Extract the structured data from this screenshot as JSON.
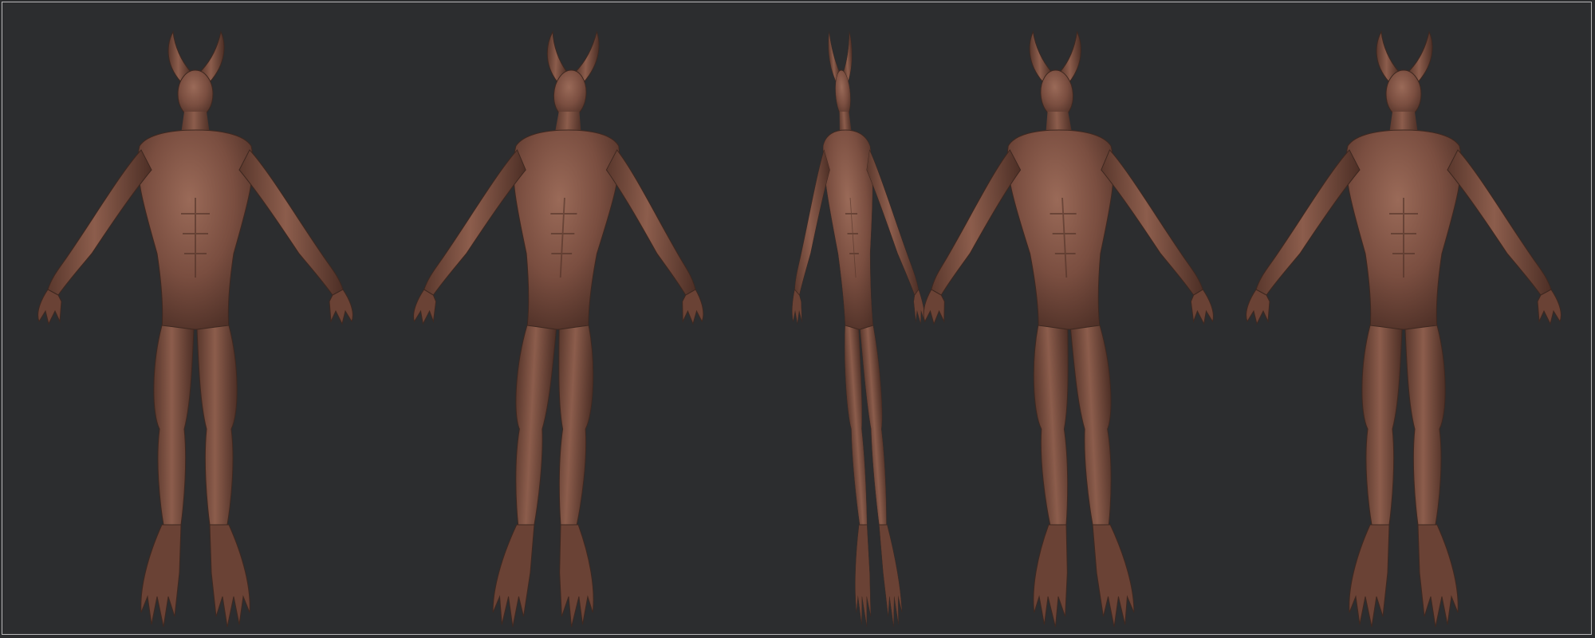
{
  "scene": {
    "subject": "horned-demon-sculpt",
    "views": [
      "front",
      "three-quarter-front",
      "side",
      "three-quarter-back",
      "back"
    ],
    "colors": {
      "background": "#2c2d2f",
      "border": "#b9b9b9",
      "skin": "#7a4e40",
      "skin_dark": "#4e3027",
      "skin_light": "#9a6a58"
    }
  }
}
